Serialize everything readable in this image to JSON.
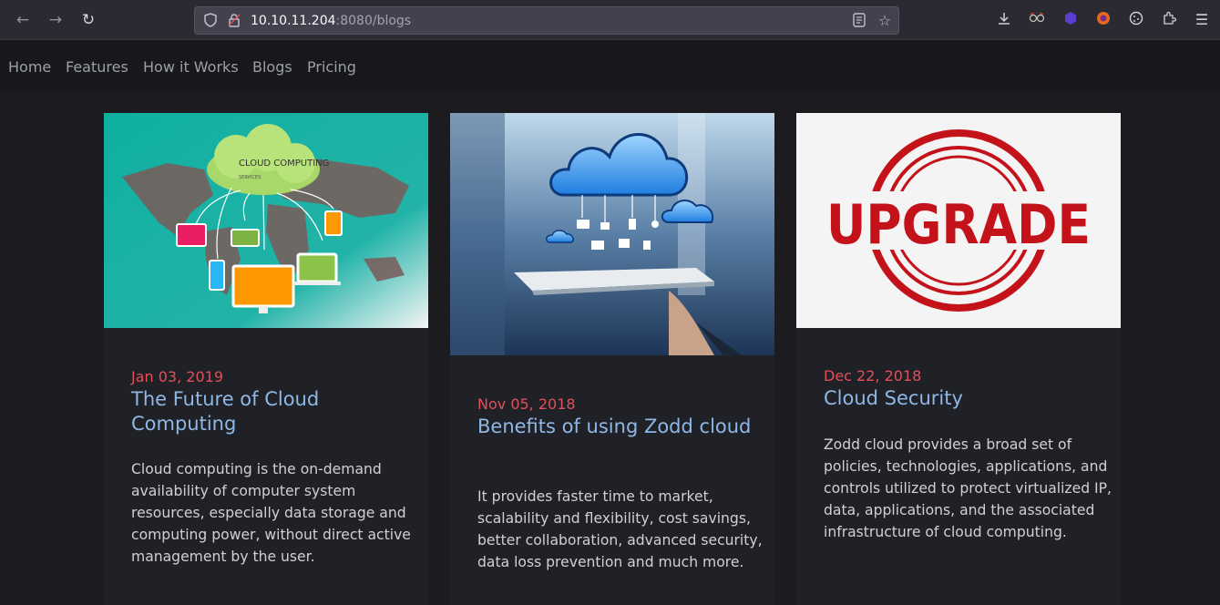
{
  "browser": {
    "url_host": "10.10.11.204",
    "url_rest": ":8080/blogs"
  },
  "nav": {
    "items": [
      "Home",
      "Features",
      "How it Works",
      "Blogs",
      "Pricing"
    ]
  },
  "posts": [
    {
      "date": "Jan 03, 2019",
      "title": "The Future of Cloud Computing",
      "body": "Cloud computing is the on-demand availability of computer system resources, especially data storage and computing power, without direct active management by the user.",
      "image_text": "CLOUD COMPUTING",
      "image_subtext": "SERVICES"
    },
    {
      "date": "Nov 05, 2018",
      "title": "Benefits of using Zodd cloud",
      "body": "It provides faster time to market, scalability and flexibility, cost savings, better collaboration, advanced security, data loss prevention and much more."
    },
    {
      "date": "Dec 22, 2018",
      "title": "Cloud Security",
      "body": "Zodd cloud provides a broad set of policies, technologies, applications, and controls utilized to protect virtualized IP, data, applications, and the associated infrastructure of cloud computing.",
      "image_text": "UPGRADE"
    }
  ],
  "colors": {
    "accent_date": "#e0505a",
    "title_link": "#8fb7e6"
  }
}
